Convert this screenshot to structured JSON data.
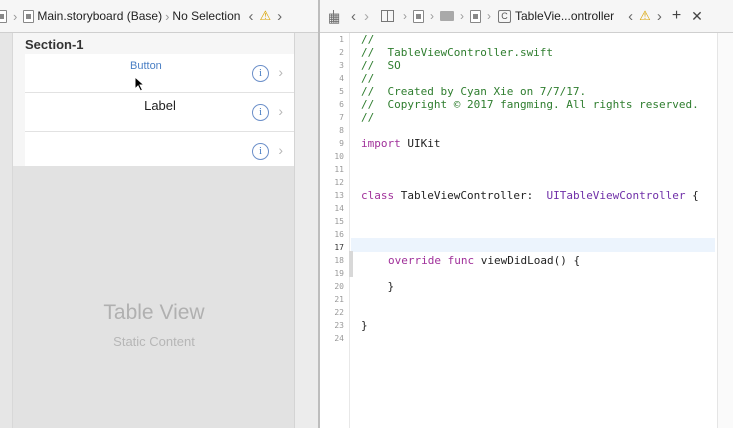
{
  "left_jumpbar": {
    "file": "Main.storyboard (Base)",
    "selection": "No Selection"
  },
  "storyboard": {
    "section_header": "Section-1",
    "cells": [
      {
        "kind": "button",
        "text": "Button"
      },
      {
        "kind": "label",
        "text": "Label"
      },
      {
        "kind": "empty",
        "text": ""
      }
    ],
    "placeholder_title": "Table View",
    "placeholder_subtitle": "Static Content"
  },
  "right_jumpbar": {
    "file": "TableVie...ontroller"
  },
  "editor": {
    "current_line": 17,
    "line_numbers": [
      "1",
      "2",
      "3",
      "4",
      "5",
      "6",
      "7",
      "8",
      "9",
      "10",
      "11",
      "12",
      "13",
      "14",
      "15",
      "16",
      "17",
      "18",
      "19",
      "20",
      "21",
      "22",
      "23",
      "24"
    ],
    "lines": {
      "l1": "//",
      "l2": "//  TableViewController.swift",
      "l3": "//  SO",
      "l4": "//",
      "l5": "//  Created by Cyan Xie on 7/7/17.",
      "l6": "//  Copyright © 2017 fangming. All rights reserved.",
      "l7": "//",
      "l9_kw": "import",
      "l9_rest": " UIKit",
      "l13_kw": "class",
      "l13_name": " TableViewController:  ",
      "l13_super": "UITableViewController",
      "l13_end": " {",
      "l18_kw1": "override",
      "l18_kw2": "func",
      "l18_rest": " viewDidLoad() {",
      "l20": "    }",
      "l23": "}"
    }
  },
  "colors": {
    "comment": "#2e7d2e",
    "keyword": "#a0309a",
    "type": "#6f2fa8",
    "link": "#4a7fc4",
    "current_line_bg": "#ecf4fd"
  }
}
